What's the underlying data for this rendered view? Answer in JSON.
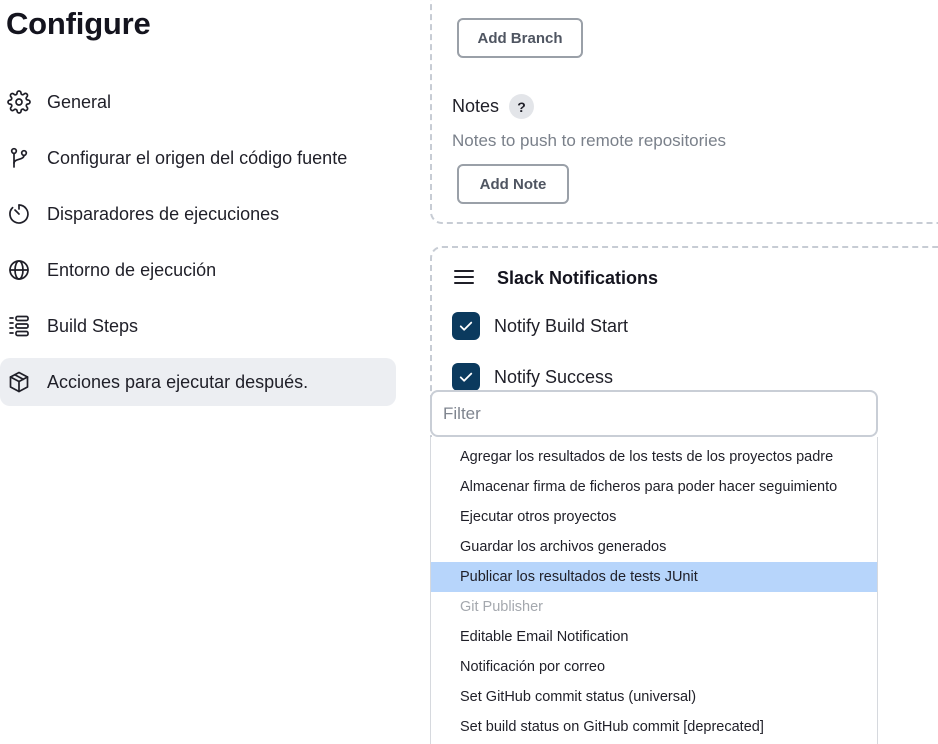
{
  "page": {
    "title": "Configure"
  },
  "sidebar": {
    "items": [
      {
        "label": "General",
        "icon": "gear-icon"
      },
      {
        "label": "Configurar el origen del código fuente",
        "icon": "branch-icon"
      },
      {
        "label": "Disparadores de ejecuciones",
        "icon": "timer-icon"
      },
      {
        "label": "Entorno de ejecución",
        "icon": "globe-icon"
      },
      {
        "label": "Build Steps",
        "icon": "list-steps-icon"
      },
      {
        "label": "Acciones para ejecutar después.",
        "icon": "package-icon",
        "active": true
      }
    ]
  },
  "git_publisher": {
    "add_branch_label": "Add Branch",
    "notes_label": "Notes",
    "help_label": "?",
    "notes_description": "Notes to push to remote repositories",
    "add_note_label": "Add Note"
  },
  "slack": {
    "title": "Slack Notifications",
    "notify_build_start": {
      "label": "Notify Build Start",
      "checked": true
    },
    "notify_success": {
      "label": "Notify Success",
      "checked": true
    }
  },
  "filter": {
    "placeholder": "Filter",
    "value": ""
  },
  "dropdown": {
    "items": [
      {
        "label": "Agregar los resultados de los tests de los proyectos padre"
      },
      {
        "label": "Almacenar firma de ficheros para poder hacer seguimiento"
      },
      {
        "label": "Ejecutar otros proyectos"
      },
      {
        "label": "Guardar los archivos generados"
      },
      {
        "label": "Publicar los resultados de tests JUnit",
        "selected": true
      },
      {
        "label": "Git Publisher",
        "disabled": true
      },
      {
        "label": "Editable Email Notification"
      },
      {
        "label": "Notificación por correo"
      },
      {
        "label": "Set GitHub commit status (universal)"
      },
      {
        "label": "Set build status on GitHub commit [deprecated]"
      }
    ]
  },
  "colors": {
    "checkbox": "#0b3a5e",
    "selected_item": "#b7d5fb",
    "active_nav": "#eceef2",
    "disabled_text": "#a4a8ae"
  }
}
